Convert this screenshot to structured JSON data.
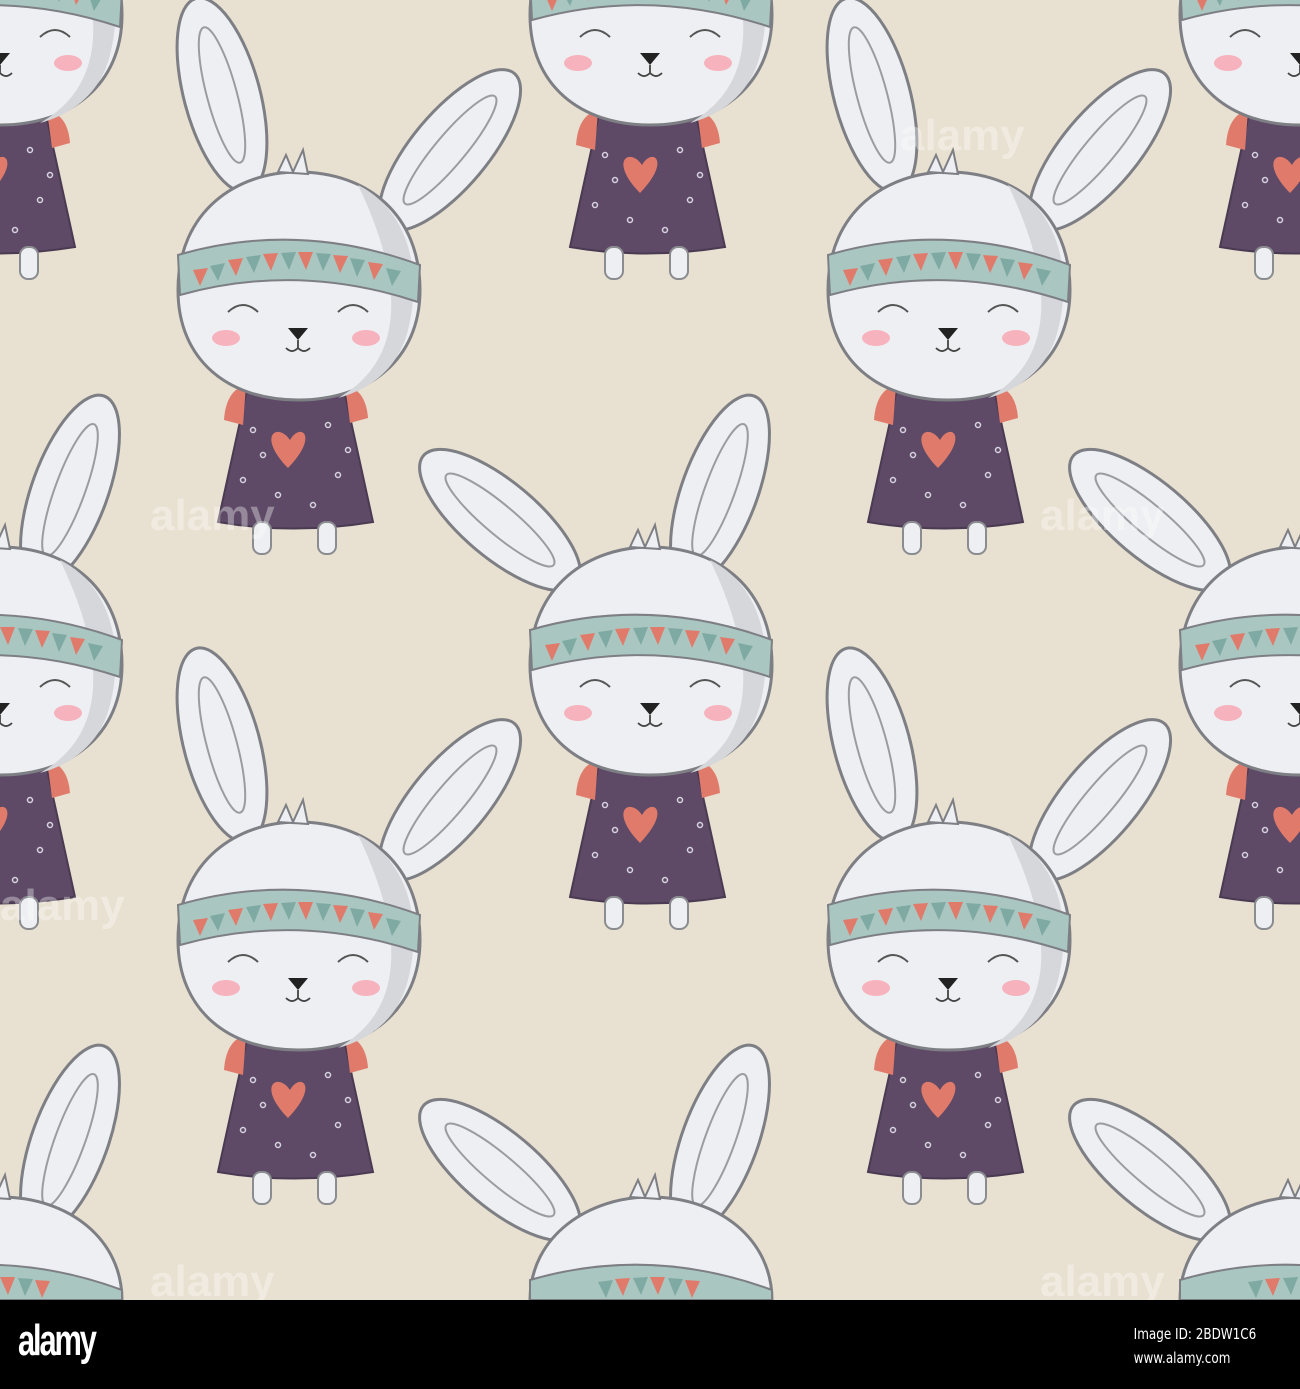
{
  "image": {
    "description_colors": {
      "background": "#e8e0d0",
      "dress": "#5e4a66",
      "sleeve": "#e07b6c",
      "fur": "#eeeff2",
      "outline": "#7d7f84",
      "band": "#a9c7c0",
      "blush": "#f6b3bd"
    },
    "watermark_text": "alamy"
  },
  "footer": {
    "logo": "alamy",
    "image_id": "Image ID: 2BDW1C6",
    "url": "www.alamy.com"
  }
}
